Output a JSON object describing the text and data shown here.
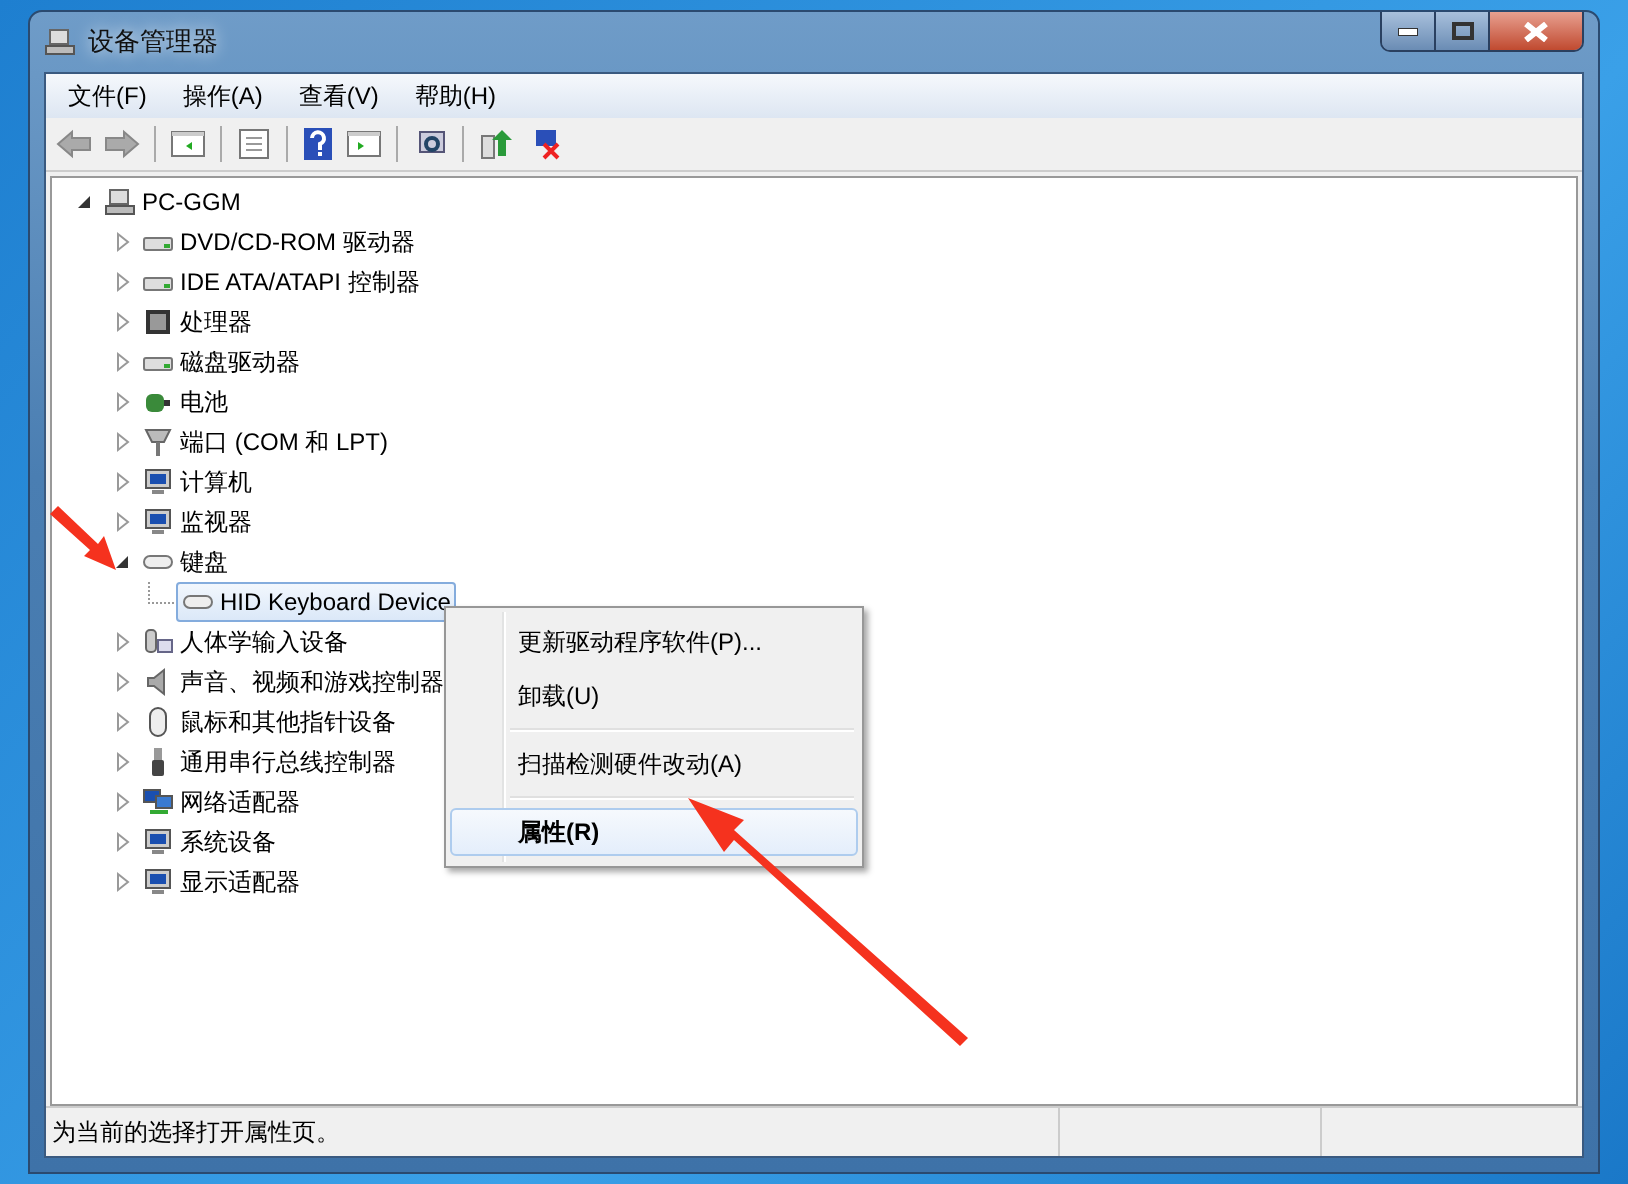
{
  "window": {
    "title": "设备管理器"
  },
  "menu_bar": [
    "文件(F)",
    "操作(A)",
    "查看(V)",
    "帮助(H)"
  ],
  "tree": {
    "label": "PC-GGM",
    "expanded": true,
    "selected": false,
    "children": [
      {
        "label": "DVD/CD-ROM 驱动器",
        "expanded": false,
        "selected": false
      },
      {
        "label": "IDE ATA/ATAPI 控制器",
        "expanded": false,
        "selected": false
      },
      {
        "label": "处理器",
        "expanded": false,
        "selected": false
      },
      {
        "label": "磁盘驱动器",
        "expanded": false,
        "selected": false
      },
      {
        "label": "电池",
        "expanded": false,
        "selected": false
      },
      {
        "label": "端口 (COM 和 LPT)",
        "expanded": false,
        "selected": false
      },
      {
        "label": "计算机",
        "expanded": false,
        "selected": false
      },
      {
        "label": "监视器",
        "expanded": false,
        "selected": false
      },
      {
        "label": "键盘",
        "expanded": true,
        "selected": false,
        "children": [
          {
            "label": "HID Keyboard Device",
            "selected": true
          }
        ]
      },
      {
        "label": "人体学输入设备",
        "expanded": false,
        "selected": false
      },
      {
        "label": "声音、视频和游戏控制器",
        "expanded": false,
        "selected": false
      },
      {
        "label": "鼠标和其他指针设备",
        "expanded": false,
        "selected": false
      },
      {
        "label": "通用串行总线控制器",
        "expanded": false,
        "selected": false
      },
      {
        "label": "网络适配器",
        "expanded": false,
        "selected": false
      },
      {
        "label": "系统设备",
        "expanded": false,
        "selected": false
      },
      {
        "label": "显示适配器",
        "expanded": false,
        "selected": false
      }
    ]
  },
  "context_menu": {
    "items": [
      {
        "kind": "item",
        "label": "更新驱动程序软件(P)...",
        "selected": false,
        "default": false
      },
      {
        "kind": "item",
        "label": "卸载(U)",
        "selected": false,
        "default": false
      },
      {
        "kind": "separator"
      },
      {
        "kind": "item",
        "label": "扫描检测硬件改动(A)",
        "selected": false,
        "default": false
      },
      {
        "kind": "separator"
      },
      {
        "kind": "item",
        "label": "属性(R)",
        "selected": true,
        "default": true
      }
    ]
  },
  "status_bar": {
    "text": "为当前的选择打开属性页。"
  }
}
